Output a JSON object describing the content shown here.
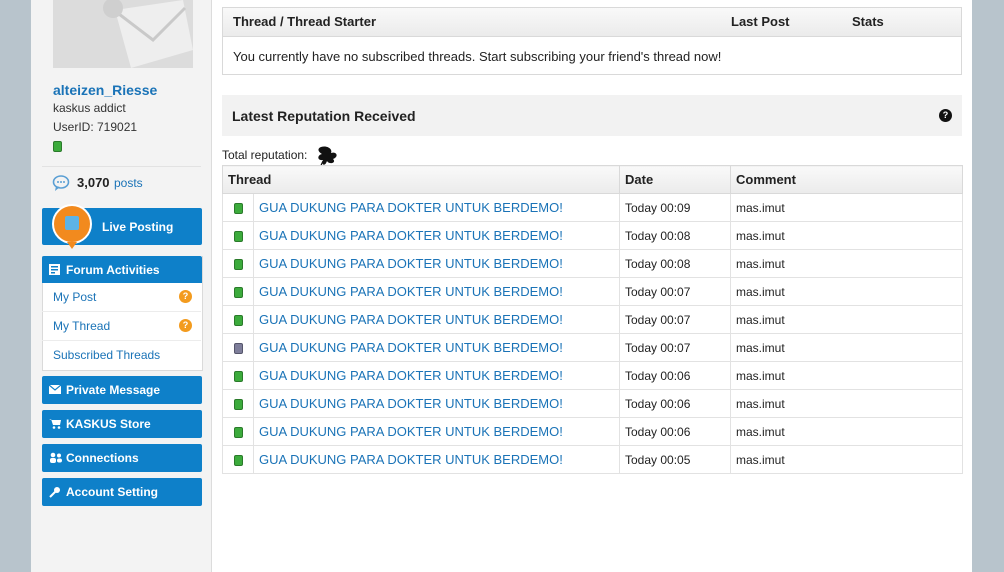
{
  "profile": {
    "username": "alteizen_Riesse",
    "title": "kaskus addict",
    "userid": "UserID: 719021",
    "post_count": "3,070",
    "posts_label": "posts"
  },
  "sidebar": {
    "live_posting": "Live Posting",
    "forum_activities": {
      "header": "Forum Activities",
      "items": [
        {
          "label": "My Post",
          "badge": "?"
        },
        {
          "label": "My Thread",
          "badge": "?"
        },
        {
          "label": "Subscribed Threads"
        }
      ]
    },
    "nav": [
      {
        "label": "Private Message",
        "icon": "envelope-icon"
      },
      {
        "label": "KASKUS Store",
        "icon": "cart-icon"
      },
      {
        "label": "Connections",
        "icon": "people-icon"
      },
      {
        "label": "Account Setting",
        "icon": "wrench-icon"
      }
    ]
  },
  "subscribed": {
    "col_thread": "Thread / Thread Starter",
    "col_last": "Last Post",
    "col_stats": "Stats",
    "empty_message": "You currently have no subscribed threads. Start subscribing your friend's thread now!"
  },
  "reputation": {
    "title": "Latest Reputation Received",
    "help": "?",
    "total_label": "Total reputation:",
    "columns": {
      "thread": "Thread",
      "date": "Date",
      "comment": "Comment"
    },
    "rows": [
      {
        "status": "green",
        "thread": "GUA DUKUNG PARA DOKTER UNTUK BERDEMO!",
        "date": "Today 00:09",
        "comment": "mas.imut"
      },
      {
        "status": "green",
        "thread": "GUA DUKUNG PARA DOKTER UNTUK BERDEMO!",
        "date": "Today 00:08",
        "comment": "mas.imut"
      },
      {
        "status": "green",
        "thread": "GUA DUKUNG PARA DOKTER UNTUK BERDEMO!",
        "date": "Today 00:08",
        "comment": "mas.imut"
      },
      {
        "status": "green",
        "thread": "GUA DUKUNG PARA DOKTER UNTUK BERDEMO!",
        "date": "Today 00:07",
        "comment": "mas.imut"
      },
      {
        "status": "green",
        "thread": "GUA DUKUNG PARA DOKTER UNTUK BERDEMO!",
        "date": "Today 00:07",
        "comment": "mas.imut"
      },
      {
        "status": "gray",
        "thread": "GUA DUKUNG PARA DOKTER UNTUK BERDEMO!",
        "date": "Today 00:07",
        "comment": "mas.imut"
      },
      {
        "status": "green",
        "thread": "GUA DUKUNG PARA DOKTER UNTUK BERDEMO!",
        "date": "Today 00:06",
        "comment": "mas.imut"
      },
      {
        "status": "green",
        "thread": "GUA DUKUNG PARA DOKTER UNTUK BERDEMO!",
        "date": "Today 00:06",
        "comment": "mas.imut"
      },
      {
        "status": "green",
        "thread": "GUA DUKUNG PARA DOKTER UNTUK BERDEMO!",
        "date": "Today 00:06",
        "comment": "mas.imut"
      },
      {
        "status": "green",
        "thread": "GUA DUKUNG PARA DOKTER UNTUK BERDEMO!",
        "date": "Today 00:05",
        "comment": "mas.imut"
      }
    ]
  },
  "colors": {
    "accent": "#0e80c9",
    "link": "#1a73b7",
    "badge": "#f39b1e",
    "online": "#3cab3c"
  }
}
